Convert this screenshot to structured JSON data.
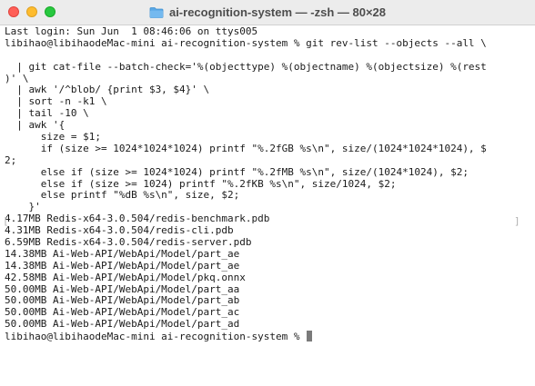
{
  "window": {
    "title": "ai-recognition-system — -zsh — 80×28",
    "title_icon": "folder-icon"
  },
  "terminal": {
    "lines": [
      "Last login: Sun Jun  1 08:46:06 on ttys005",
      "libihao@libihaodeMac-mini ai-recognition-system % git rev-list --objects --all \\",
      "",
      "  | git cat-file --batch-check='%(objecttype) %(objectname) %(objectsize) %(rest",
      ")' \\",
      "  | awk '/^blob/ {print $3, $4}' \\",
      "  | sort -n -k1 \\",
      "  | tail -10 \\",
      "  | awk '{",
      "      size = $1;",
      "      if (size >= 1024*1024*1024) printf \"%.2fGB %s\\n\", size/(1024*1024*1024), $",
      "2;",
      "      else if (size >= 1024*1024) printf \"%.2fMB %s\\n\", size/(1024*1024), $2;",
      "      else if (size >= 1024) printf \"%.2fKB %s\\n\", size/1024, $2;",
      "      else printf \"%dB %s\\n\", size, $2;",
      "    }'",
      "4.17MB Redis-x64-3.0.504/redis-benchmark.pdb",
      "4.31MB Redis-x64-3.0.504/redis-cli.pdb",
      "6.59MB Redis-x64-3.0.504/redis-server.pdb",
      "14.38MB Ai-Web-API/WebApi/Model/part_ae",
      "14.38MB Ai-Web-API/WebApi/Model/part_ae",
      "42.58MB Ai-Web-API/WebApi/Model/pkq.onnx",
      "50.00MB Ai-Web-API/WebApi/Model/part_aa",
      "50.00MB Ai-Web-API/WebApi/Model/part_ab",
      "50.00MB Ai-Web-API/WebApi/Model/part_ac",
      "50.00MB Ai-Web-API/WebApi/Model/part_ad"
    ],
    "prompt": "libihao@libihaodeMac-mini ai-recognition-system % "
  },
  "colors": {
    "close": "#ff5f57",
    "minimize": "#febc2e",
    "maximize": "#28c840",
    "text": "#1a1a1a",
    "background": "#ffffff"
  }
}
